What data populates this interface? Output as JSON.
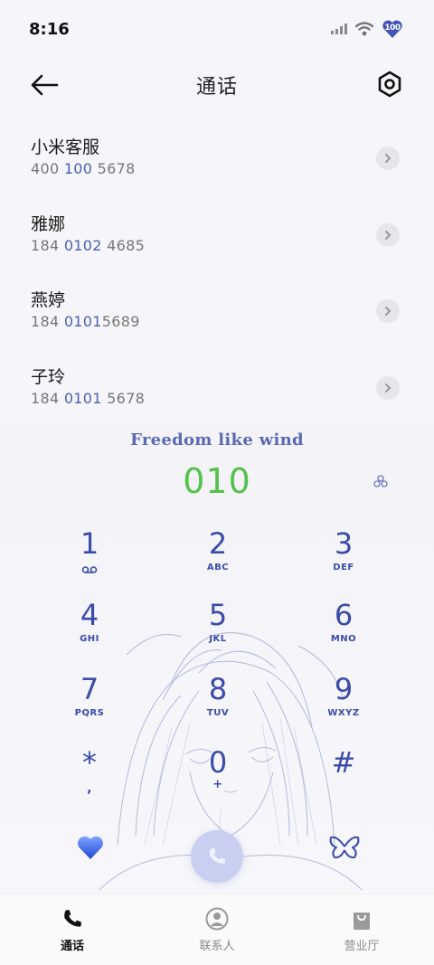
{
  "status_bar": {
    "time": "8:16",
    "battery": "100",
    "icons": [
      "signal-icon",
      "wifi-icon",
      "battery-heart-icon"
    ]
  },
  "header": {
    "title": "通话",
    "back_icon": "arrow-left-icon",
    "settings_icon": "settings-hexagon-icon"
  },
  "contacts": [
    {
      "name": "小米客服",
      "number_pre": "400 ",
      "number_hl": "100",
      "number_post": " 5678"
    },
    {
      "name": "雅娜",
      "number_pre": "184 ",
      "number_hl": "0102",
      "number_post": " 4685"
    },
    {
      "name": "燕婷",
      "number_pre": "184 ",
      "number_hl": "0101",
      "number_post": "5689"
    },
    {
      "name": "子玲",
      "number_pre": "184 ",
      "number_hl": "0101",
      "number_post": " 5678"
    }
  ],
  "dialer": {
    "motto": "Freedom like wind",
    "entered_number": "010",
    "keys": [
      {
        "digit": "1",
        "letters": ""
      },
      {
        "digit": "2",
        "letters": "ABC"
      },
      {
        "digit": "3",
        "letters": "DEF"
      },
      {
        "digit": "4",
        "letters": "GHI"
      },
      {
        "digit": "5",
        "letters": "JKL"
      },
      {
        "digit": "6",
        "letters": "MNO"
      },
      {
        "digit": "7",
        "letters": "PQRS"
      },
      {
        "digit": "8",
        "letters": "TUV"
      },
      {
        "digit": "9",
        "letters": "WXYZ"
      },
      {
        "digit": "*",
        "letters": ","
      },
      {
        "digit": "0",
        "letters": "+"
      },
      {
        "digit": "#",
        "letters": ""
      }
    ],
    "accent": "#3a4ba8",
    "number_color": "#55c24d"
  },
  "tabs": [
    {
      "label": "通话",
      "icon": "phone-icon",
      "active": true
    },
    {
      "label": "联系人",
      "icon": "person-icon",
      "active": false
    },
    {
      "label": "营业厅",
      "icon": "bag-icon",
      "active": false
    }
  ]
}
